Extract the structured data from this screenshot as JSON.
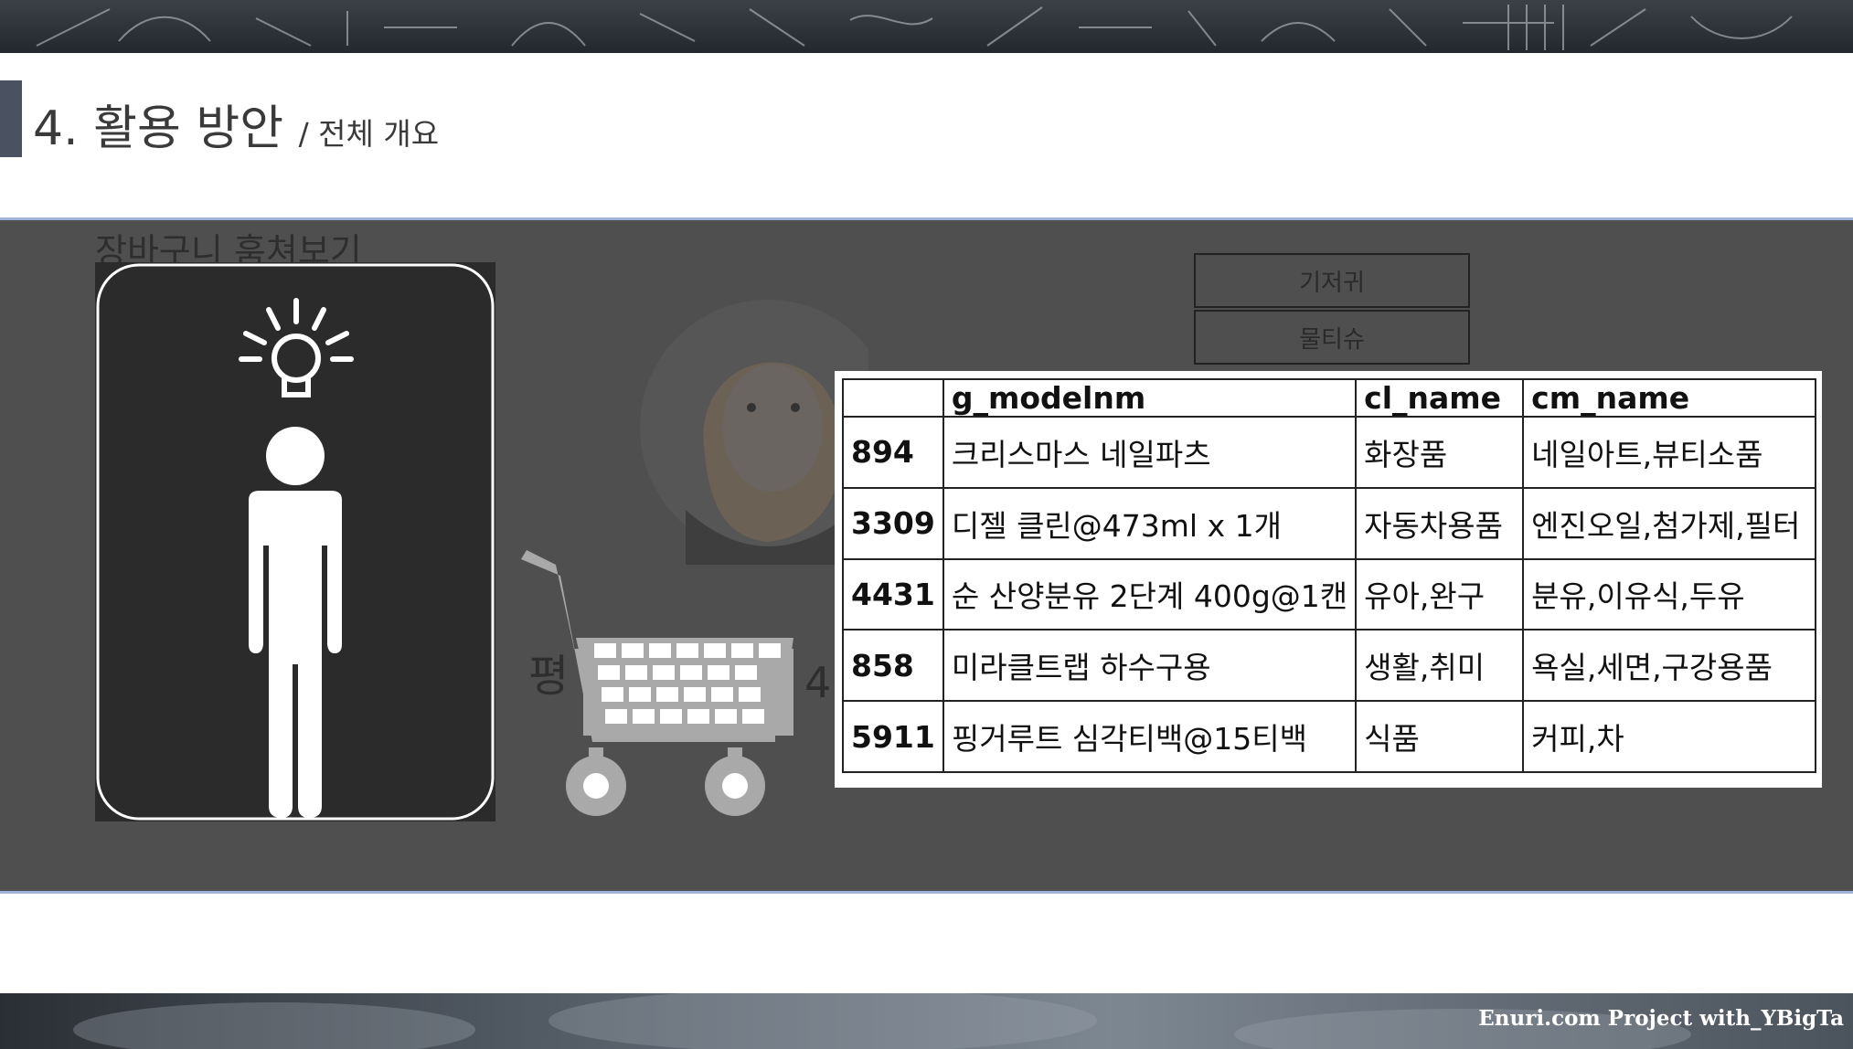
{
  "slide": {
    "title": "4. 활용 방안",
    "subtitle": "/ 전체 개요",
    "section_heading": "장바구니 훔쳐보기",
    "faded_label_left": "평",
    "faded_label_right": "4 /",
    "footer": "Enuri.com Project with_YBigTa"
  },
  "tags": [
    "기저귀",
    "물티슈"
  ],
  "table": {
    "headers": [
      "",
      "g_modelnm",
      "cl_name",
      "cm_name"
    ],
    "rows": [
      {
        "id": "894",
        "model": "크리스마스 네일파츠",
        "cl": "화장품",
        "cm": "네일아트,뷰티소품"
      },
      {
        "id": "3309",
        "model": "디젤 클린@473ml x 1개",
        "cl": "자동차용품",
        "cm": "엔진오일,첨가제,필터"
      },
      {
        "id": "4431",
        "model": "순 산양분유 2단계 400g@1캔",
        "cl": "유아,완구",
        "cm": "분유,이유식,두유"
      },
      {
        "id": "858",
        "model": "미라클트랩 하수구용",
        "cl": "생활,취미",
        "cm": "욕실,세면,구강용품"
      },
      {
        "id": "5911",
        "model": "핑거루트 심각티백@15티백",
        "cl": "식품",
        "cm": "커피,차"
      }
    ]
  },
  "colors": {
    "panel": "#4f4f4f",
    "title_accent": "#4a5160",
    "rule": "#9eb3d6"
  },
  "icons": [
    "lightbulb-icon",
    "person-icon",
    "shopping-cart-icon",
    "avatar-icon"
  ]
}
